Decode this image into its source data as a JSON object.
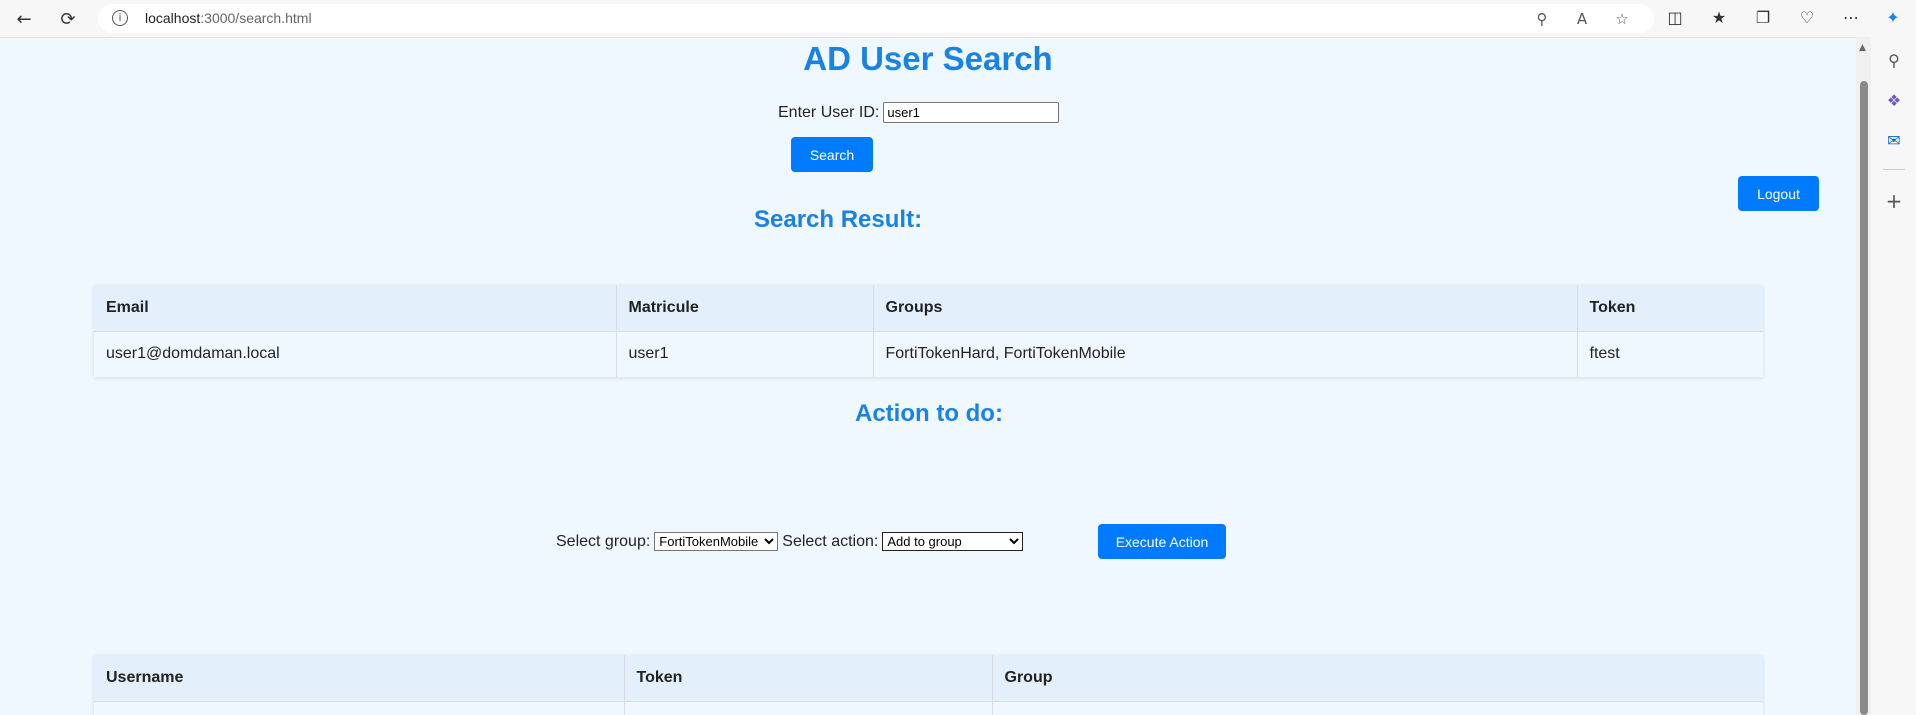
{
  "browser": {
    "url_host": "localhost",
    "url_path": ":3000/search.html"
  },
  "page": {
    "title": "AD User Search",
    "userid_label": "Enter User ID:",
    "userid_value": "user1",
    "search_label": "Search",
    "logout_label": "Logout",
    "search_result_title": "Search Result:",
    "result_table": {
      "headers": [
        "Email",
        "Matricule",
        "Groups",
        "Token"
      ],
      "rows": [
        [
          "user1@domdaman.local",
          "user1",
          "FortiTokenHard, FortiTokenMobile",
          "ftest"
        ]
      ]
    },
    "action_title": "Action to do:",
    "select_group_label": "Select group:",
    "select_group_value": "FortiTokenMobile",
    "select_action_label": "Select action:",
    "select_action_value": "Add to group",
    "execute_label": "Execute Action",
    "bottom_table": {
      "headers": [
        "Username",
        "Token",
        "Group"
      ]
    }
  },
  "colors": {
    "accent": "#007bff",
    "heading": "#1a82e2",
    "page_bg": "#f0f8ff"
  }
}
